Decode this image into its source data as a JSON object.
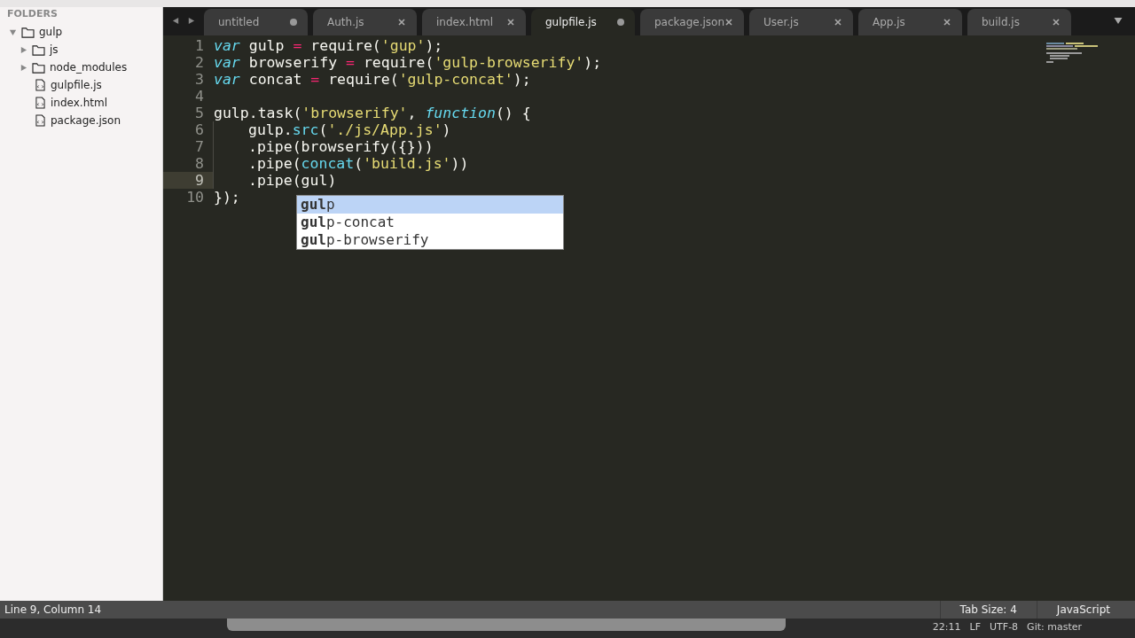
{
  "sidebar": {
    "heading": "FOLDERS",
    "tree": [
      {
        "label": "gulp",
        "kind": "folder",
        "expanded": true,
        "children": [
          {
            "label": "js",
            "kind": "folder",
            "expanded": false
          },
          {
            "label": "node_modules",
            "kind": "folder",
            "expanded": false
          },
          {
            "label": "gulpfile.js",
            "kind": "file"
          },
          {
            "label": "index.html",
            "kind": "file"
          },
          {
            "label": "package.json",
            "kind": "file"
          }
        ]
      }
    ]
  },
  "tabs": [
    {
      "label": "untitled",
      "selected": false,
      "modified": true
    },
    {
      "label": "Auth.js",
      "selected": false,
      "modified": false
    },
    {
      "label": "index.html",
      "selected": false,
      "modified": false
    },
    {
      "label": "gulpfile.js",
      "selected": true,
      "modified": true
    },
    {
      "label": "package.json",
      "selected": false,
      "modified": false
    },
    {
      "label": "User.js",
      "selected": false,
      "modified": false
    },
    {
      "label": "App.js",
      "selected": false,
      "modified": false
    },
    {
      "label": "build.js",
      "selected": false,
      "modified": false
    }
  ],
  "editor": {
    "lines": [
      {
        "number": "1",
        "current": false,
        "indented": false,
        "tokens": [
          {
            "text": "var",
            "kind": "keyword"
          },
          {
            "text": " gulp ",
            "kind": "plain"
          },
          {
            "text": "=",
            "kind": "operator"
          },
          {
            "text": " require(",
            "kind": "plain"
          },
          {
            "text": "'gup'",
            "kind": "string"
          },
          {
            "text": ");",
            "kind": "plain"
          }
        ]
      },
      {
        "number": "2",
        "current": false,
        "indented": false,
        "tokens": [
          {
            "text": "var",
            "kind": "keyword"
          },
          {
            "text": " browserify ",
            "kind": "plain"
          },
          {
            "text": "=",
            "kind": "operator"
          },
          {
            "text": " require(",
            "kind": "plain"
          },
          {
            "text": "'gulp-browserify'",
            "kind": "string"
          },
          {
            "text": ");",
            "kind": "plain"
          }
        ]
      },
      {
        "number": "3",
        "current": false,
        "indented": false,
        "tokens": [
          {
            "text": "var",
            "kind": "keyword"
          },
          {
            "text": " concat ",
            "kind": "plain"
          },
          {
            "text": "=",
            "kind": "operator"
          },
          {
            "text": " require(",
            "kind": "plain"
          },
          {
            "text": "'gulp-concat'",
            "kind": "string"
          },
          {
            "text": ");",
            "kind": "plain"
          }
        ]
      },
      {
        "number": "4",
        "current": false
      },
      {
        "number": "5",
        "current": false,
        "indented": false,
        "tokens": [
          {
            "text": "gulp.task(",
            "kind": "plain"
          },
          {
            "text": "'browserify'",
            "kind": "string"
          },
          {
            "text": ", ",
            "kind": "plain"
          },
          {
            "text": "function",
            "kind": "keyword"
          },
          {
            "text": "() {",
            "kind": "plain"
          }
        ]
      },
      {
        "number": "6",
        "current": false,
        "indented": true,
        "tokens": [
          {
            "text": "gulp.",
            "kind": "plain"
          },
          {
            "text": "src",
            "kind": "function"
          },
          {
            "text": "(",
            "kind": "plain"
          },
          {
            "text": "'./js/App.js'",
            "kind": "string"
          },
          {
            "text": ")",
            "kind": "plain"
          }
        ]
      },
      {
        "number": "7",
        "current": false,
        "indented": true,
        "tokens": [
          {
            "text": ".pipe(browserify({}))",
            "kind": "plain"
          }
        ]
      },
      {
        "number": "8",
        "current": false,
        "indented": true,
        "tokens": [
          {
            "text": ".pipe(",
            "kind": "plain"
          },
          {
            "text": "concat",
            "kind": "function"
          },
          {
            "text": "(",
            "kind": "plain"
          },
          {
            "text": "'build.js'",
            "kind": "string"
          },
          {
            "text": "))",
            "kind": "plain"
          }
        ]
      },
      {
        "number": "9",
        "current": true,
        "indented": true,
        "tokens": [
          {
            "text": ".pipe(gul)",
            "kind": "plain"
          }
        ]
      },
      {
        "number": "10",
        "current": false,
        "indented": false,
        "tokens": [
          {
            "text": "});",
            "kind": "plain"
          }
        ]
      }
    ],
    "autocomplete": [
      {
        "text": "**gul**p",
        "selected": true
      },
      {
        "text": "**gul**p-concat",
        "selected": false
      },
      {
        "text": "**gul**p-browserify",
        "selected": false
      }
    ]
  },
  "status_bar": {
    "position": "Line 9, Column 14",
    "tab_size": "Tab Size: 4",
    "syntax": "JavaScript"
  },
  "menu_bar_strip": [
    "22:11",
    "LF",
    "UTF-8",
    "Git: master"
  ]
}
